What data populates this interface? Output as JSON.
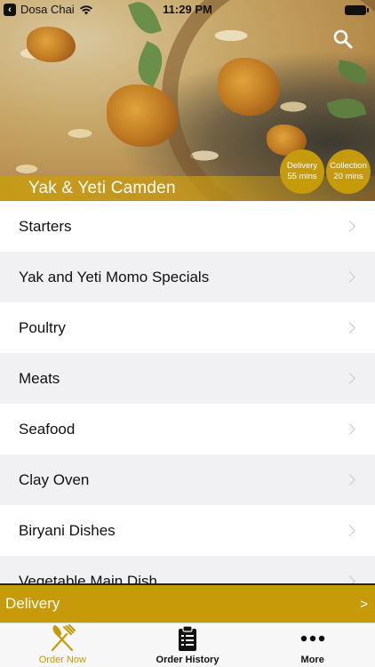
{
  "status_bar": {
    "back_app": "Dosa Chai",
    "time": "11:29 PM"
  },
  "restaurant": {
    "name": "Yak & Yeti Camden",
    "delivery_badge": {
      "label": "Delivery",
      "time": "55 mins"
    },
    "collection_badge": {
      "label": "Collection",
      "time": "20 mins"
    }
  },
  "menu": {
    "categories": [
      "Starters",
      "Yak and Yeti Momo Specials",
      "Poultry",
      "Meats",
      "Seafood",
      "Clay Oven",
      "Biryani Dishes",
      "Vegetable Main Dish"
    ]
  },
  "order_mode": {
    "label": "Delivery",
    "arrow": ">"
  },
  "tabs": [
    {
      "label": "Order Now",
      "icon": "fork-knife-icon",
      "active": true
    },
    {
      "label": "Order History",
      "icon": "clipboard-icon",
      "active": false
    },
    {
      "label": "More",
      "icon": "more-dots-icon",
      "active": false
    }
  ],
  "colors": {
    "accent": "#c79a0a",
    "tab_inactive": "#111111",
    "row_alt": "#f1f1f3"
  }
}
